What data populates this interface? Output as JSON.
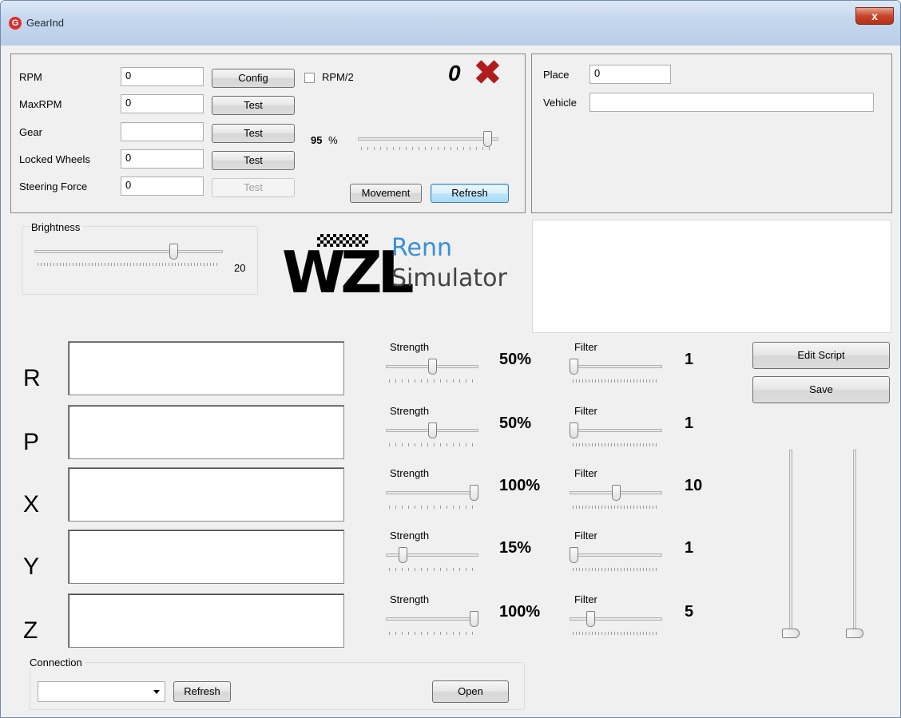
{
  "window": {
    "title": "GearInd",
    "close_glyph": "x"
  },
  "telemetry": {
    "rpm_label": "RPM",
    "rpm_value": "0",
    "maxrpm_label": "MaxRPM",
    "maxrpm_value": "0",
    "gear_label": "Gear",
    "gear_value": "",
    "locked_label": "Locked Wheels",
    "locked_value": "0",
    "steering_label": "Steering Force",
    "steering_value": "0",
    "config_label": "Config",
    "test_label": "Test",
    "rpm2_label": "RPM/2",
    "rpm2_checked": false,
    "status_value": "0",
    "status_icon": "x-icon",
    "percent_value": "95",
    "percent_unit": "%",
    "percent_level": 95,
    "movement_label": "Movement",
    "refresh_label": "Refresh"
  },
  "info": {
    "place_label": "Place",
    "place_value": "0",
    "vehicle_label": "Vehicle",
    "vehicle_value": ""
  },
  "brightness": {
    "label": "Brightness",
    "value": "20",
    "level": 0.75
  },
  "logo": {
    "mark": "WZL",
    "line1": "Renn",
    "line2": "Simulator",
    "accent": "#3a8fd6"
  },
  "axes": [
    {
      "letter": "R",
      "strength_label": "Strength",
      "strength": "50%",
      "strength_level": 0.5,
      "filter_label": "Filter",
      "filter": "1",
      "filter_level": 0.0
    },
    {
      "letter": "P",
      "strength_label": "Strength",
      "strength": "50%",
      "strength_level": 0.5,
      "filter_label": "Filter",
      "filter": "1",
      "filter_level": 0.0
    },
    {
      "letter": "X",
      "strength_label": "Strength",
      "strength": "100%",
      "strength_level": 1.0,
      "filter_label": "Filter",
      "filter": "10",
      "filter_level": 0.5
    },
    {
      "letter": "Y",
      "strength_label": "Strength",
      "strength": "15%",
      "strength_level": 0.15,
      "filter_label": "Filter",
      "filter": "1",
      "filter_level": 0.0
    },
    {
      "letter": "Z",
      "strength_label": "Strength",
      "strength": "100%",
      "strength_level": 1.0,
      "filter_label": "Filter",
      "filter": "5",
      "filter_level": 0.2
    }
  ],
  "script": {
    "edit_label": "Edit Script",
    "save_label": "Save"
  },
  "vertical_sliders": [
    {
      "level": 0.0
    },
    {
      "level": 0.0
    }
  ],
  "connection": {
    "label": "Connection",
    "selected": "",
    "refresh_label": "Refresh",
    "open_label": "Open"
  }
}
